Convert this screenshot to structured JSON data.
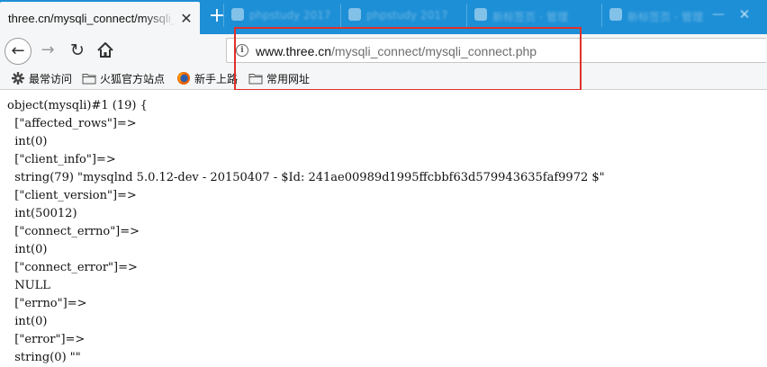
{
  "browser": {
    "active_tab": {
      "title": "three.cn/mysqli_connect/mysqli_",
      "close_glyph": "✕"
    },
    "new_tab_glyph": "+",
    "background_tabs": [
      {
        "icon": "page-icon",
        "label": "phpstudy 2017"
      },
      {
        "icon": "page-icon",
        "label": "phpstudy 2017"
      },
      {
        "icon": "page-icon",
        "label": "新标签页 - 管理"
      },
      {
        "icon": "page-icon",
        "label": "新标签页 - 管理"
      }
    ],
    "window_controls": {
      "minimize": "—",
      "close": "✕"
    },
    "nav": {
      "back_glyph": "←",
      "forward_glyph": "→",
      "reload_glyph": "↻",
      "home_icon": "home-icon"
    },
    "url": {
      "domain": "www.three.cn",
      "path": "/mysqli_connect/mysqli_connect.php",
      "info_glyph": "i"
    },
    "bookmarks": [
      {
        "icon": "gear-icon",
        "label": "最常访问"
      },
      {
        "icon": "folder-icon",
        "label": "火狐官方站点"
      },
      {
        "icon": "firefox-icon",
        "label": "新手上路"
      },
      {
        "icon": "folder-icon",
        "label": "常用网址"
      }
    ]
  },
  "highlight_color": "#e0302a",
  "page": {
    "lines": [
      "object(mysqli)#1 (19) {",
      "  [\"affected_rows\"]=>",
      "  int(0)",
      "  [\"client_info\"]=>",
      "  string(79) \"mysqlnd 5.0.12-dev - 20150407 - $Id: 241ae00989d1995ffcbbf63d579943635faf9972 $\"",
      "  [\"client_version\"]=>",
      "  int(50012)",
      "  [\"connect_errno\"]=>",
      "  int(0)",
      "  [\"connect_error\"]=>",
      "  NULL",
      "  [\"errno\"]=>",
      "  int(0)",
      "  [\"error\"]=>",
      "  string(0) \"\""
    ]
  }
}
